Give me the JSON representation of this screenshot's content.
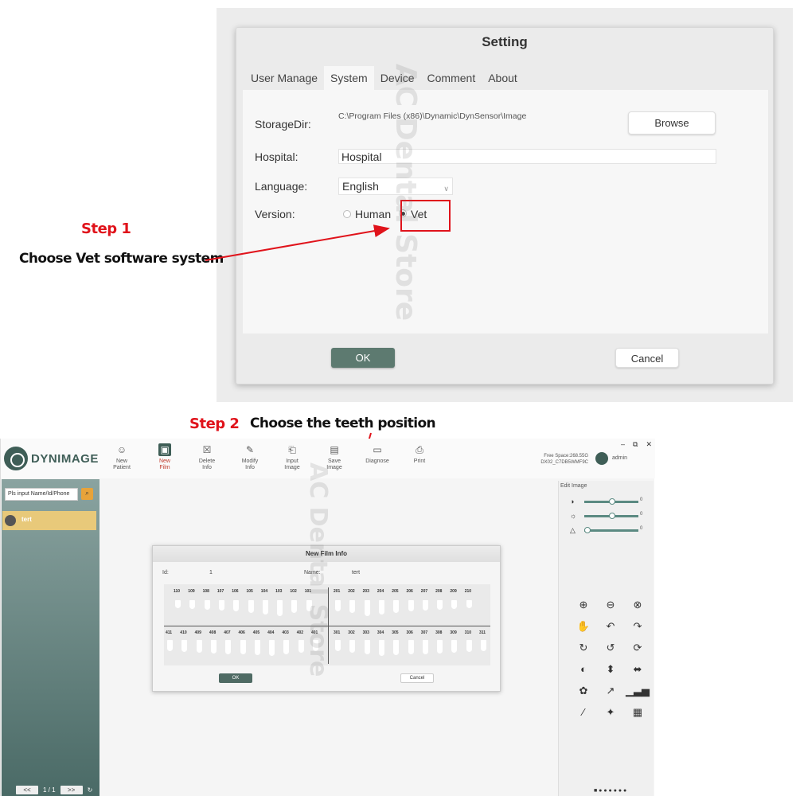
{
  "settings": {
    "title": "Setting",
    "tabs": [
      "User Manage",
      "System",
      "Device",
      "Comment",
      "About"
    ],
    "storage_label": "StorageDir:",
    "storage_path": "C:\\Program Files (x86)\\Dynamic\\DynSensor\\Image",
    "browse": "Browse",
    "hospital_label": "Hospital:",
    "hospital_value": "Hospital",
    "language_label": "Language:",
    "language_value": "English",
    "version_label": "Version:",
    "version_human": "Human",
    "version_vet": "Vet",
    "ok": "OK",
    "cancel": "Cancel"
  },
  "annotations": {
    "step1": "Step 1",
    "step1_text": "Choose Vet software system",
    "step2": "Step 2",
    "step2_text": "Choose the teeth position",
    "accent_color": "#e0131b"
  },
  "app": {
    "logo": "DYNIMAGE",
    "toolbar": [
      {
        "label1": "New",
        "label2": "Patient",
        "icon": "person-add-icon"
      },
      {
        "label1": "New",
        "label2": "Film",
        "icon": "film-icon"
      },
      {
        "label1": "Delete",
        "label2": "Info",
        "icon": "trash-icon"
      },
      {
        "label1": "Modify",
        "label2": "Info",
        "icon": "edit-icon"
      },
      {
        "label1": "Input",
        "label2": "Image",
        "icon": "image-import-icon"
      },
      {
        "label1": "Save",
        "label2": "Image",
        "icon": "save-icon"
      },
      {
        "label1": "Diagnose",
        "label2": "",
        "icon": "chat-icon"
      },
      {
        "label1": "Print",
        "label2": "",
        "icon": "printer-icon"
      }
    ],
    "free_space": "Free Space:268.55G",
    "device_id": "DX02_C7DB5WMF9C",
    "user": "admin",
    "search_placeholder": "Pls input Name/Id/Phone",
    "patient_name": "tert",
    "pager_prev": "<<",
    "pager_text": "1 / 1",
    "pager_next": ">>",
    "edit_image_title": "Edit Image",
    "slider_values": [
      "0",
      "0",
      "0"
    ],
    "slider_levels": [
      0.5,
      0.5,
      0.0
    ]
  },
  "new_film": {
    "title": "New Film Info",
    "id_label": "Id:",
    "id_value": "1",
    "name_label": "Name:",
    "name_value": "tert",
    "upper_left": [
      "110",
      "109",
      "108",
      "107",
      "106",
      "105",
      "104",
      "103",
      "102",
      "101"
    ],
    "upper_right": [
      "201",
      "202",
      "203",
      "204",
      "205",
      "206",
      "207",
      "208",
      "209",
      "210"
    ],
    "lower_left": [
      "411",
      "410",
      "409",
      "408",
      "407",
      "406",
      "405",
      "404",
      "403",
      "402",
      "401"
    ],
    "lower_right": [
      "301",
      "302",
      "303",
      "304",
      "305",
      "306",
      "307",
      "308",
      "309",
      "310",
      "311"
    ],
    "ok": "OK",
    "cancel": "Cancel"
  },
  "watermark": "AC Dental Store"
}
